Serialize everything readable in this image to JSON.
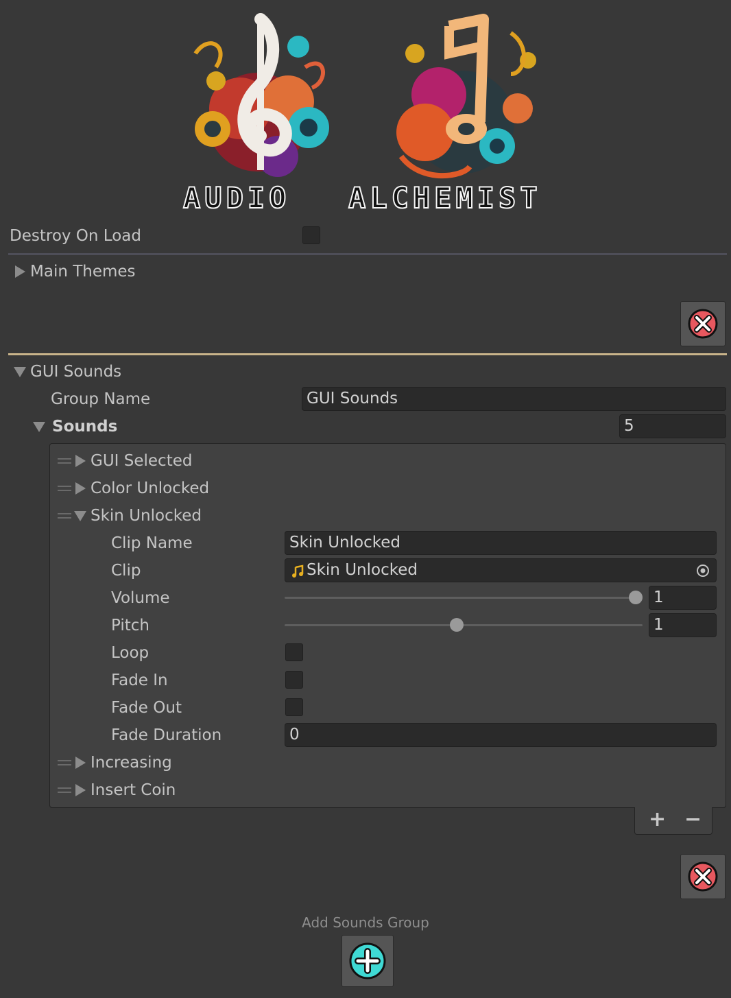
{
  "logo": {
    "title_left": "AUDIO",
    "title_right": "ALCHEMIST"
  },
  "destroy_on_load": {
    "label": "Destroy On Load",
    "checked": false
  },
  "main_themes": {
    "label": "Main Themes",
    "expanded": false
  },
  "gui_sounds": {
    "label": "GUI Sounds",
    "expanded": true,
    "group_name_label": "Group Name",
    "group_name_value": "GUI Sounds",
    "sounds_label": "Sounds",
    "sounds_count": "5",
    "items": [
      {
        "label": "GUI Selected",
        "expanded": false
      },
      {
        "label": "Color Unlocked",
        "expanded": false
      },
      {
        "label": "Skin Unlocked",
        "expanded": true
      },
      {
        "label": "Increasing",
        "expanded": false
      },
      {
        "label": "Insert Coin",
        "expanded": false
      }
    ],
    "selected_item": {
      "clip_name_label": "Clip Name",
      "clip_name_value": "Skin Unlocked",
      "clip_label": "Clip",
      "clip_value": "Skin Unlocked",
      "clip_icon": "music-note-icon",
      "volume_label": "Volume",
      "volume_value": "1",
      "volume_fraction": 1.0,
      "pitch_label": "Pitch",
      "pitch_value": "1",
      "pitch_fraction": 0.48,
      "loop_label": "Loop",
      "loop_checked": false,
      "fade_in_label": "Fade In",
      "fade_in_checked": false,
      "fade_out_label": "Fade Out",
      "fade_out_checked": false,
      "fade_duration_label": "Fade Duration",
      "fade_duration_value": "0"
    },
    "add_item_symbol": "+",
    "remove_item_symbol": "−"
  },
  "add_sounds_group": {
    "label": "Add Sounds Group"
  },
  "colors": {
    "background": "#383838",
    "accent_divider": "#c9b48a",
    "delete_red": "#e8585f",
    "add_cyan": "#3fd9d4"
  }
}
